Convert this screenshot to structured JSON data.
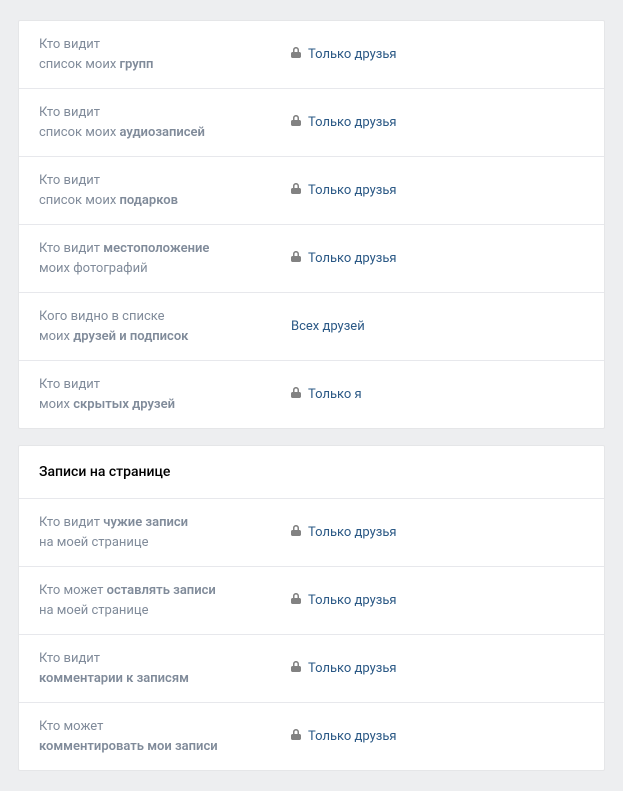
{
  "section1": {
    "items": [
      {
        "label_pre": "Кто видит",
        "label_line2_pre": "список моих ",
        "label_bold": "групп",
        "label_post": "",
        "value": "Только друзья",
        "locked": true
      },
      {
        "label_pre": "Кто видит",
        "label_line2_pre": "список моих ",
        "label_bold": "аудиозаписей",
        "label_post": "",
        "value": "Только друзья",
        "locked": true
      },
      {
        "label_pre": "Кто видит",
        "label_line2_pre": "список моих ",
        "label_bold": "подарков",
        "label_post": "",
        "value": "Только друзья",
        "locked": true
      },
      {
        "label_pre": "Кто видит ",
        "label_bold": "местоположение",
        "label_line2_pre": "",
        "label_post": "моих фотографий",
        "value": "Только друзья",
        "locked": true,
        "bold_first_line": true
      },
      {
        "label_pre": "Кого видно в списке",
        "label_line2_pre": "моих ",
        "label_bold": "друзей и подписок",
        "label_post": "",
        "value": "Всех друзей",
        "locked": false
      },
      {
        "label_pre": "Кто видит",
        "label_line2_pre": "моих ",
        "label_bold": "скрытых друзей",
        "label_post": "",
        "value": "Только я",
        "locked": true
      }
    ]
  },
  "section2": {
    "header": "Записи на странице",
    "items": [
      {
        "label_pre": "Кто видит ",
        "label_bold": "чужие записи",
        "label_line2_pre": "",
        "label_post": "на моей странице",
        "value": "Только друзья",
        "locked": true,
        "bold_first_line": true
      },
      {
        "label_pre": "Кто может ",
        "label_bold": "оставлять записи",
        "label_line2_pre": "",
        "label_post": "на моей странице",
        "value": "Только друзья",
        "locked": true,
        "bold_first_line": true
      },
      {
        "label_pre": "Кто видит",
        "label_line2_pre": "",
        "label_bold": "комментарии к записям",
        "label_post": "",
        "value": "Только друзья",
        "locked": true
      },
      {
        "label_pre": "Кто может",
        "label_line2_pre": "",
        "label_bold": "комментировать мои записи",
        "label_post": "",
        "value": "Только друзья",
        "locked": true
      }
    ]
  }
}
